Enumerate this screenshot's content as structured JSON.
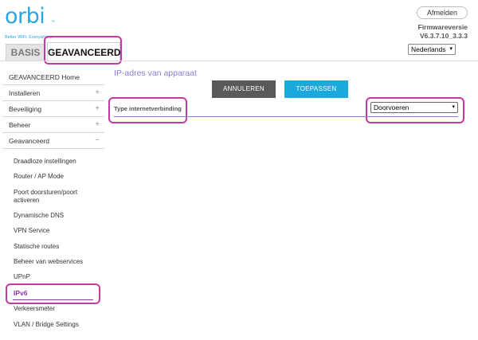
{
  "brand": {
    "logo": "orbi",
    "tagline": "Better WiFi. Everywhere",
    "trademark": "™"
  },
  "header": {
    "logout_label": "Afmelden",
    "firmware_label": "Firmwareversie",
    "firmware_version": "V6.3.7.10_3.3.3",
    "language": "Nederlands"
  },
  "tabs": [
    {
      "label": "BASIS"
    },
    {
      "label": "GEAVANCEERD"
    }
  ],
  "sidebar": {
    "top": [
      {
        "label": "GEAVANCEERD Home",
        "toggle": ""
      },
      {
        "label": "Installeren",
        "toggle": "+"
      },
      {
        "label": "Beveiliging",
        "toggle": "+"
      },
      {
        "label": "Beheer",
        "toggle": "+"
      },
      {
        "label": "Geavanceerd",
        "toggle": "−"
      }
    ],
    "sub": [
      {
        "label": "Draadloze instellingen"
      },
      {
        "label": "Router / AP Mode"
      },
      {
        "label": "Poort doorsturen/poort activeren"
      },
      {
        "label": "Dynamische DNS"
      },
      {
        "label": "VPN Service"
      },
      {
        "label": "Statische routes"
      },
      {
        "label": "Beheer van webservices"
      },
      {
        "label": "UPnP"
      },
      {
        "label": "IPv6"
      },
      {
        "label": "Verkeersmeter"
      },
      {
        "label": "VLAN / Bridge Settings"
      }
    ]
  },
  "main": {
    "title": "IP-adres van apparaat",
    "cancel_label": "ANNULEREN",
    "apply_label": "TOEPASSEN",
    "connection_type_label": "Type internetverbinding",
    "connection_type_value": "Doorvoeren"
  },
  "colors": {
    "brand_blue": "#2aa6df",
    "title_purple": "#8a7cd6",
    "active_purple": "#8e36ab",
    "highlight_magenta": "#c43aa3",
    "apply_blue": "#19a9dc",
    "cancel_gray": "#595959"
  }
}
